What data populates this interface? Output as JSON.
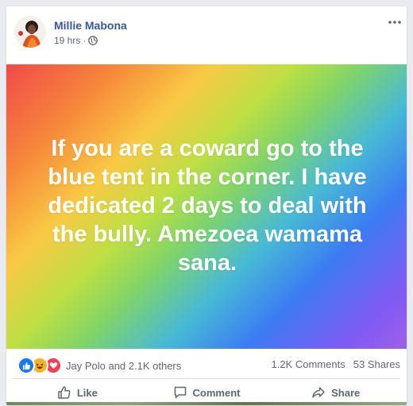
{
  "post": {
    "author": "Millie Mabona",
    "time": "19 hrs",
    "separator": "·",
    "text": "If you are a coward go to the blue tent in the corner. I have dedicated 2 days to deal with the bully. Amezoea wamama sana.",
    "background_gradient": [
      "#f04a4a",
      "#f6863a",
      "#f9c944",
      "#bddf43",
      "#7fd46a",
      "#47b9d6",
      "#3c7cf3",
      "#7e5bf3",
      "#a05ee8"
    ]
  },
  "stats": {
    "reactions": [
      "like-icon",
      "haha-icon",
      "love-icon"
    ],
    "reaction_summary": "Jay Polo and 2.1K others",
    "comments": "1.2K Comments",
    "shares": "53 Shares"
  },
  "actions": {
    "like": "Like",
    "comment": "Comment",
    "share": "Share"
  },
  "colors": {
    "author_link": "#385898",
    "secondary_text": "#606770",
    "like_blue": "#1877f2",
    "haha_yellow": "#f7b125",
    "love_red": "#f33e58"
  }
}
